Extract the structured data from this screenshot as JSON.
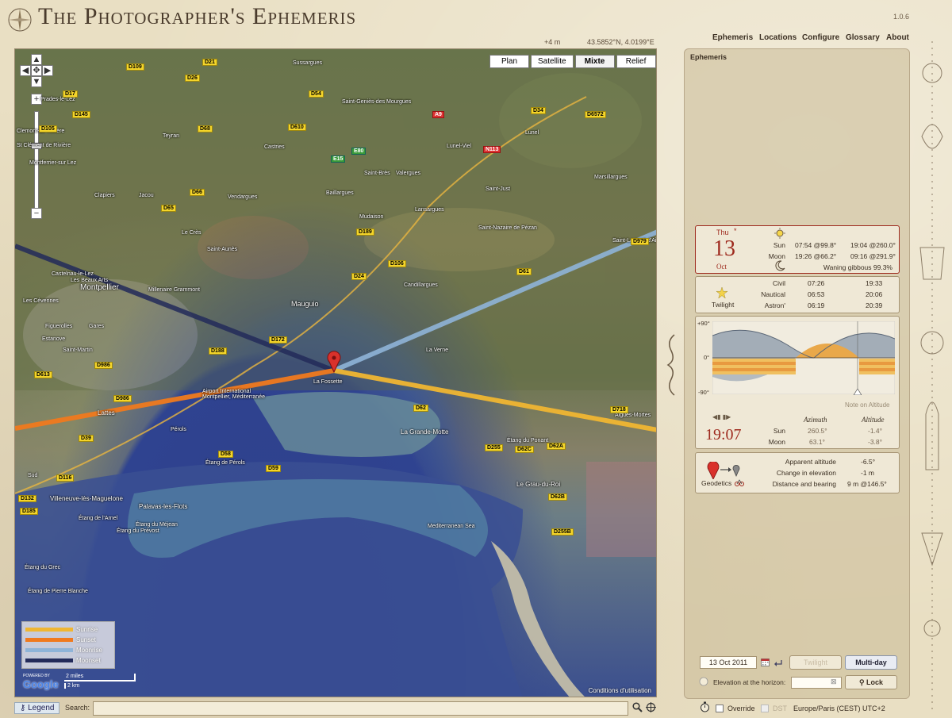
{
  "app": {
    "title": "The Photographer's Ephemeris",
    "version": "1.0.6"
  },
  "header": {
    "elevation": "+4 m",
    "coordinates": "43.5852°N, 4.0199°E",
    "nav": [
      "Ephemeris",
      "Locations",
      "Configure",
      "Glossary",
      "About"
    ]
  },
  "map": {
    "types": [
      "Plan",
      "Satellite",
      "Mixte",
      "Relief"
    ],
    "active_type": "Mixte",
    "legend": [
      {
        "label": "Sunrise",
        "color": "#f0b632"
      },
      {
        "label": "Sunset",
        "color": "#f07a1e"
      },
      {
        "label": "Moonrise",
        "color": "#8fb4d8"
      },
      {
        "label": "Moonset",
        "color": "#232b5a"
      }
    ],
    "scale": {
      "miles": "2 miles",
      "km": "2 km"
    },
    "powered_by": "POWERED BY",
    "google": "Google",
    "credit": "Conditions d'utilisation",
    "places": [
      "Sussargues",
      "Saint-Geniès-des Mourgues",
      "Prades-le-Lez",
      "Clemont-de-Rivière",
      "St Clément de Rivière",
      "Montferrier-sur Lez",
      "Teyran",
      "Castries",
      "Lunel-Viel",
      "Lunel",
      "Clapiers",
      "Jacou",
      "Vendargues",
      "Baillargues",
      "Saint-Brès",
      "Valergues",
      "Saint-Just",
      "Marsillargues",
      "Le Crès",
      "Mudaison",
      "Lansargues",
      "Saint-Nazaire de Pézan",
      "Saint-Aunès",
      "Castelnau-le-Lez",
      "Millenaire Grammont",
      "Candillargues",
      "Saint-Laurent d'Ai",
      "Les Beaux Arts",
      "Les Cévennes",
      "Montpellier",
      "Mauguio",
      "Figuerolles",
      "Gares",
      "Estanove",
      "Saint-Martin",
      "La Verne",
      "La Fossette",
      "Lattes",
      "Airport International Montpellier, Méditerranée",
      "Pérols",
      "La Grande-Motte",
      "Aigues-Mortes",
      "Étang de Pérols",
      "Étang du Ponant",
      "Étang du Méjean",
      "Villeneuve-lès-Maguelone",
      "Palavas-les-Flots",
      "Le Grau-du-Roi",
      "Étang de l'Arnel",
      "Étang du Prévost",
      "Mediterranean Sea",
      "Étang du Grec",
      "Étang de Pierre Blanche",
      "Sud"
    ],
    "roads": [
      "D109",
      "D21",
      "D26",
      "D17",
      "D68",
      "D145",
      "D610",
      "D54",
      "D6572",
      "D34",
      "N113",
      "A9",
      "E15",
      "E80",
      "D105",
      "D65",
      "D986",
      "D189",
      "D24",
      "D172",
      "D106",
      "D61",
      "D979",
      "D62",
      "D66",
      "D58",
      "D59",
      "D255",
      "D62C",
      "D62A",
      "D62B",
      "D255B",
      "D116",
      "D132",
      "D185",
      "D613",
      "D39",
      "D188",
      "D986",
      "D718"
    ]
  },
  "search": {
    "legend_button": "Legend",
    "label": "Search:",
    "placeholder": ""
  },
  "panel": {
    "title": "Ephemeris",
    "date": {
      "weekday": "Thu",
      "day": "13",
      "month": "Oct"
    },
    "sun": {
      "label": "Sun",
      "rise": "07:54 @99.8°",
      "set": "19:04 @260.0°"
    },
    "moon": {
      "label": "Moon",
      "rise": "19:26 @66.2°",
      "set": "09:16 @291.9°",
      "phase": "Waning gibbous 99.3%"
    },
    "twilight": {
      "label": "Twilight",
      "rows": [
        {
          "name": "Civil",
          "morning": "07:26",
          "evening": "19:33"
        },
        {
          "name": "Nautical",
          "morning": "06:53",
          "evening": "20:06"
        },
        {
          "name": "Astron'",
          "morning": "06:19",
          "evening": "20:39"
        }
      ]
    },
    "altitude_chart": {
      "ymax": "+90°",
      "yzero": "0°",
      "ymin": "-90°",
      "note": "Note on Altitude",
      "time": "19:07",
      "azimuth_header": "Azimuth",
      "altitude_header": "Altitude",
      "rows": [
        {
          "name": "Sun",
          "azimuth": "260.5°",
          "altitude": "-1.4°"
        },
        {
          "name": "Moon",
          "azimuth": "63.1°",
          "altitude": "-3.8°"
        }
      ]
    },
    "geodetics": {
      "label": "Geodetics",
      "rows": [
        {
          "name": "Apparent altitude",
          "value": "-6.5°"
        },
        {
          "name": "Change in elevation",
          "value": "-1 m"
        },
        {
          "name": "Distance and bearing",
          "value": "9 m @146.5°"
        }
      ]
    },
    "controls": {
      "date_value": "13 Oct 2011",
      "twilight_button": "Twilight",
      "multiday_button": "Multi-day",
      "horizon_label": "Elevation at the horizon:",
      "lock_button": "Lock"
    },
    "footer": {
      "override": "Override",
      "dst": "DST",
      "timezone": "Europe/Paris (CEST) UTC+2"
    }
  }
}
